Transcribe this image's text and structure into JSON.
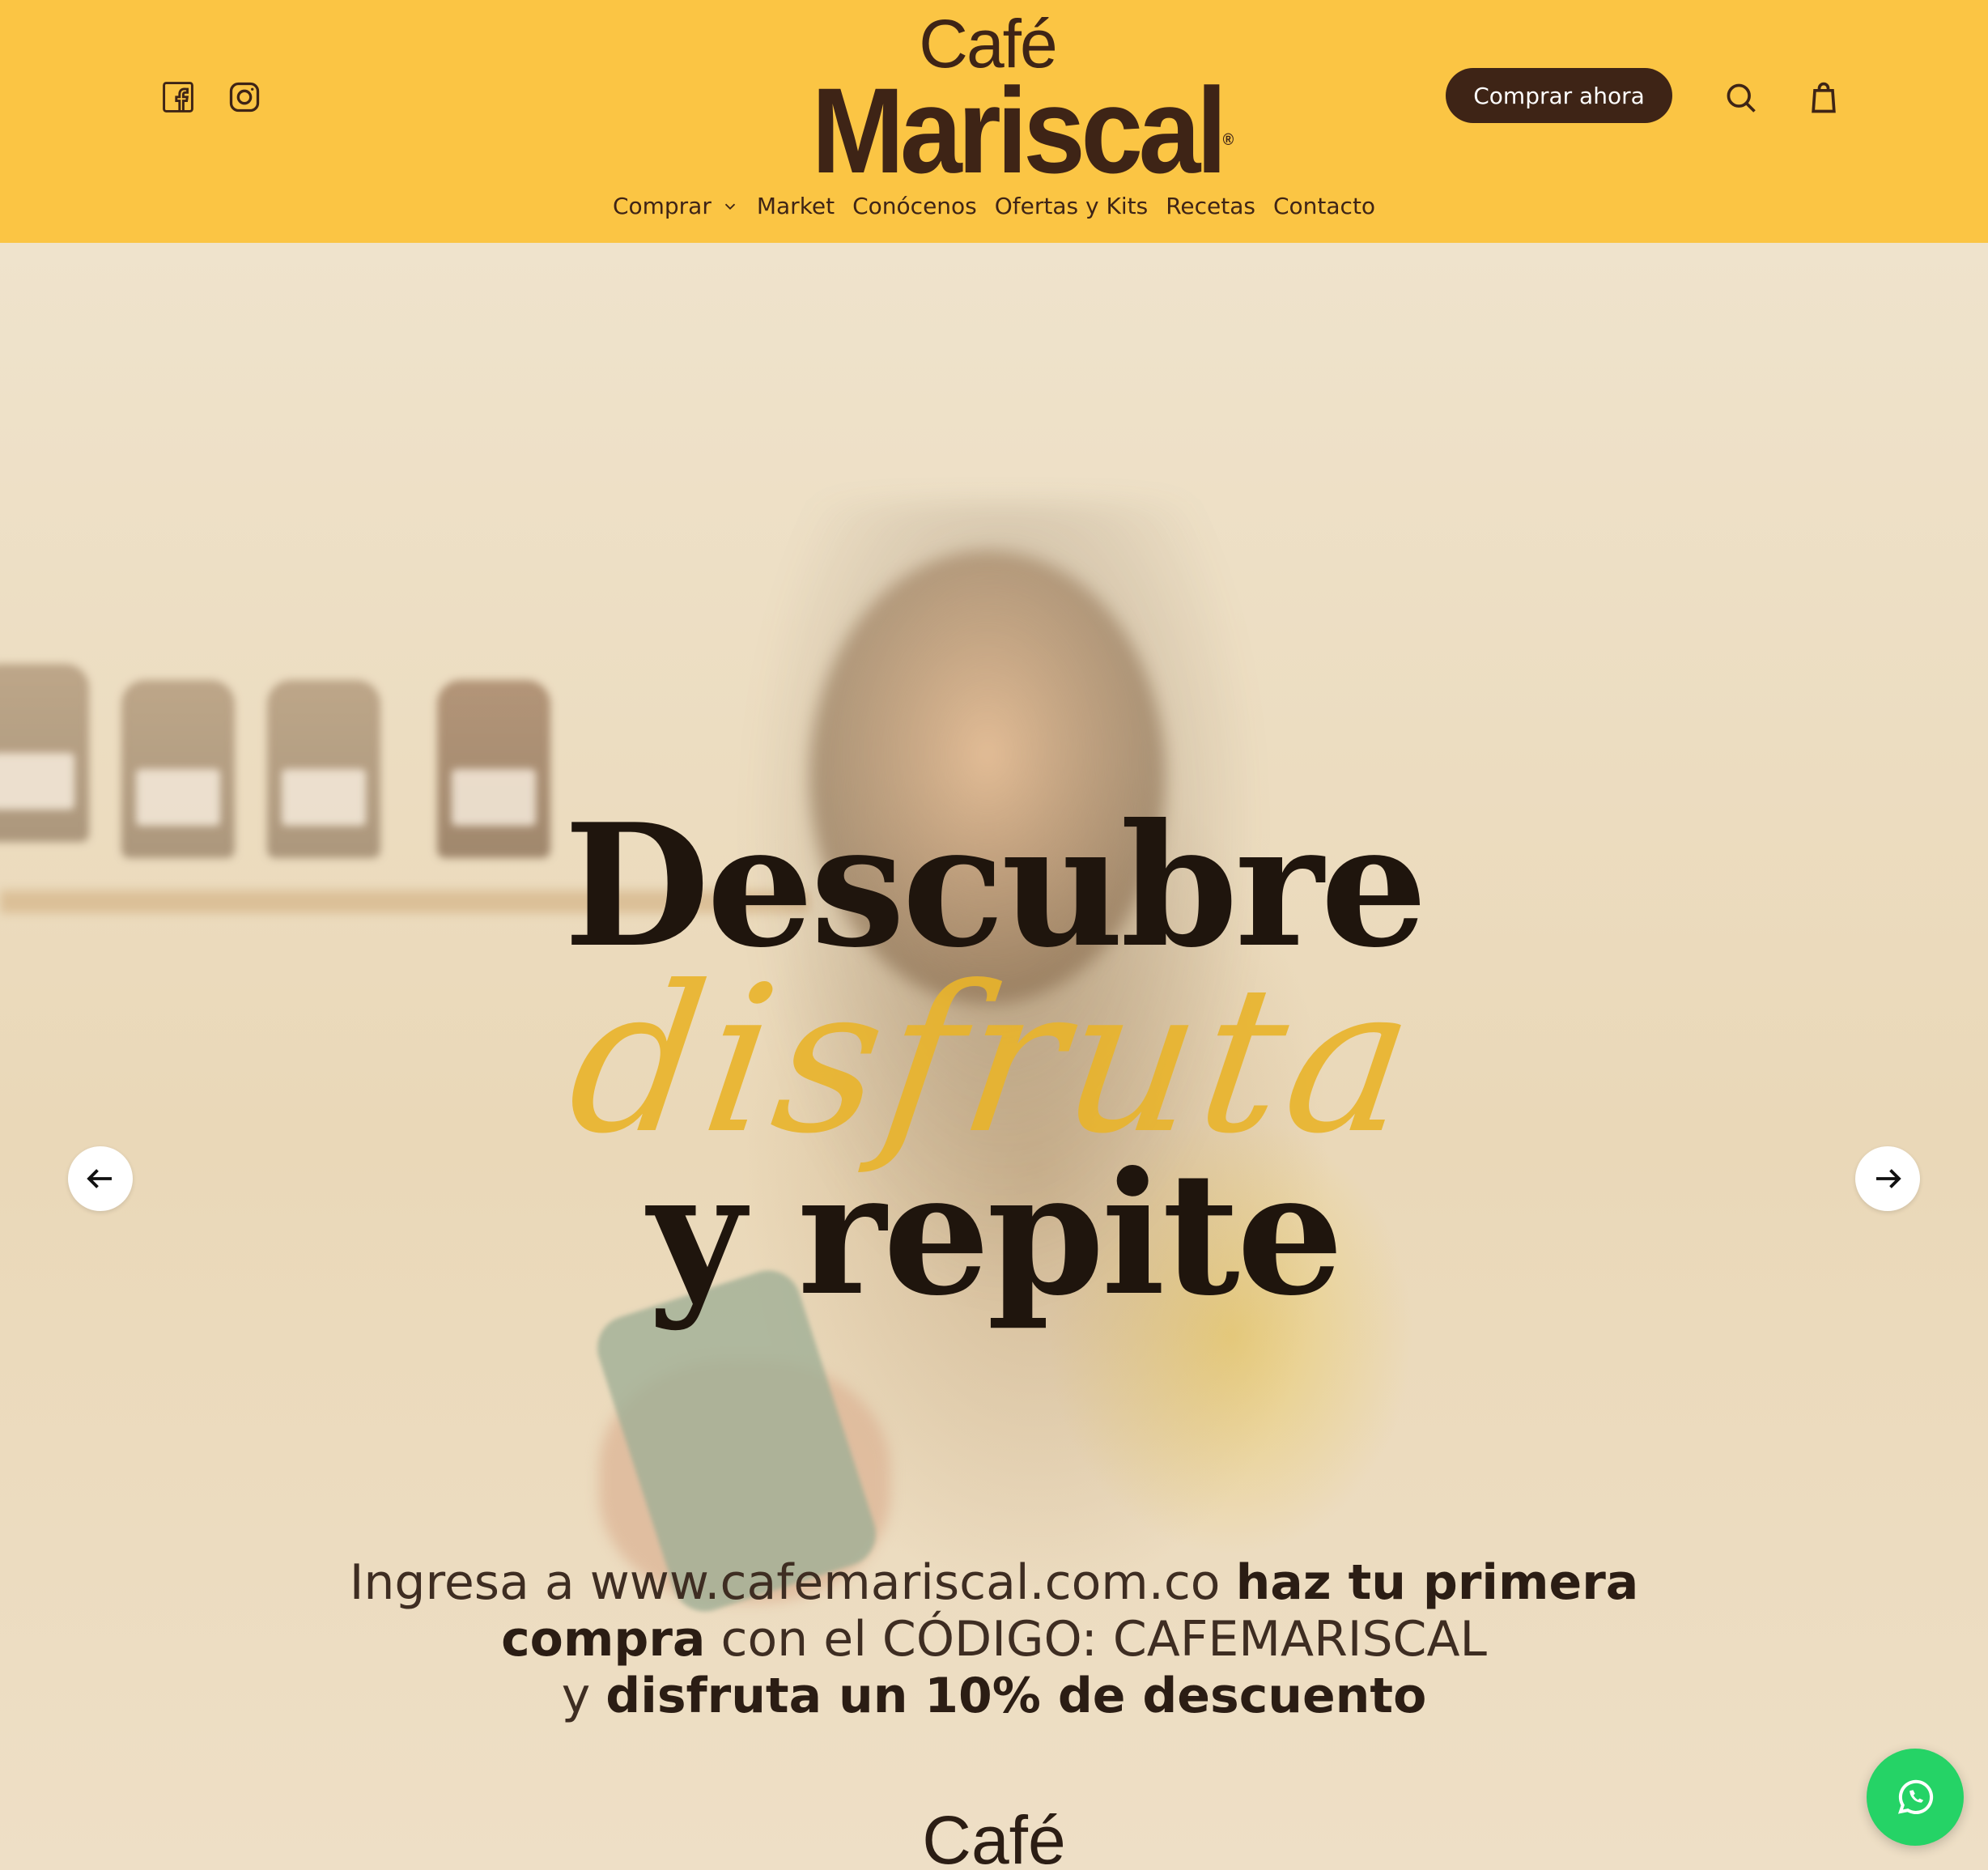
{
  "header": {
    "social_icons": [
      "facebook-icon",
      "instagram-icon"
    ],
    "logo": {
      "line1": "Café",
      "line2": "Mariscal",
      "reg": "®"
    },
    "nav": [
      "Comprar",
      "Market",
      "Conócenos",
      "Ofertas y Kits",
      "Recetas",
      "Contacto"
    ],
    "cta_label": "Comprar ahora",
    "icons": [
      "search-icon",
      "shopping-bag-icon"
    ]
  },
  "hero": {
    "headline_1": "Descubre",
    "script_word": "disfruta",
    "headline_2": "y repite",
    "promo": {
      "line1_normal": "Ingresa a www.cafemariscal.com.co ",
      "line1_bold": "haz tu primera",
      "line2_bold": "compra",
      "line2_normal": " con el CÓDIGO: CAFEMARISCAL",
      "line3_normal": "y ",
      "line3_bold": "disfruta un 10% de descuento"
    },
    "footer_logo": "Café",
    "prev_icon": "arrow-left-icon",
    "next_icon": "arrow-right-icon"
  },
  "floating": {
    "icon": "whatsapp-icon"
  },
  "colors": {
    "header_bg": "#fbc544",
    "brand_brown": "#3e2416",
    "script_yellow": "#e9b42b",
    "whatsapp_green": "#25d366"
  }
}
